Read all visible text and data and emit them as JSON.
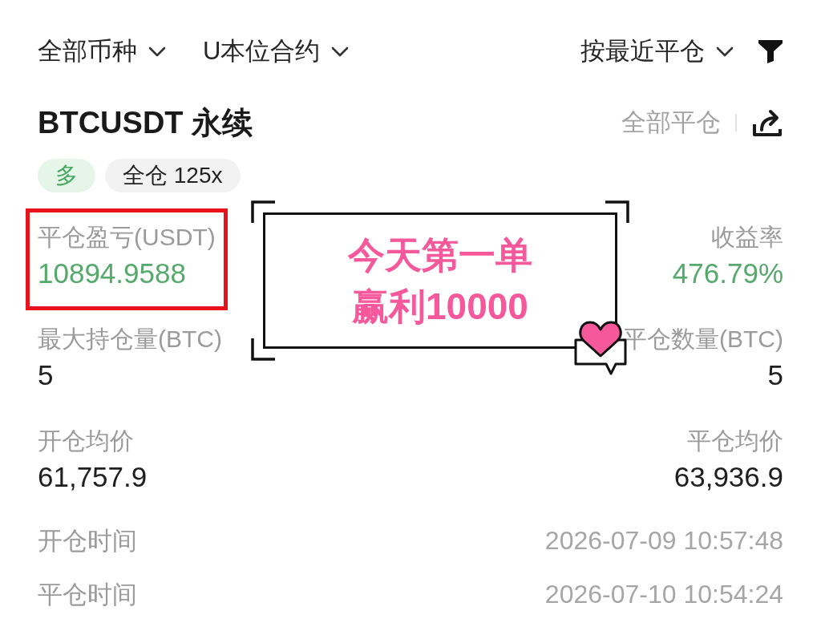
{
  "filters": [
    {
      "label": "全部币种"
    },
    {
      "label": "U本位合约"
    }
  ],
  "sort": {
    "label": "按最近平仓"
  },
  "position": {
    "symbol": "BTCUSDT 永续",
    "close_all": "全部平仓",
    "tags": [
      {
        "kind": "side",
        "label": "多"
      },
      {
        "kind": "margin",
        "label": "全仓 125x"
      }
    ]
  },
  "stats": [
    {
      "label": "平仓盈亏(USDT)",
      "value": "10894.9588",
      "kind": "gain",
      "highlighted": true
    },
    {
      "label": "收益率",
      "value": "476.79%",
      "kind": "gain",
      "highlighted": false
    },
    {
      "label": "最大持仓量(BTC)",
      "value": "5",
      "kind": "amount",
      "highlighted": false
    },
    {
      "label": "平仓数量(BTC)",
      "value": "5",
      "kind": "amount",
      "highlighted": false
    },
    {
      "label": "开仓均价",
      "value": "61,757.9",
      "kind": "amount",
      "highlighted": false
    },
    {
      "label": "平仓均价",
      "value": "63,936.9",
      "kind": "amount",
      "highlighted": false
    }
  ],
  "times": [
    {
      "label": "开仓时间",
      "value": "2026-07-09 10:57:48"
    },
    {
      "label": "平仓时间",
      "value": "2026-07-10 10:54:24"
    }
  ],
  "sticker": {
    "lines": [
      "今天第一单",
      "赢利10000"
    ]
  }
}
